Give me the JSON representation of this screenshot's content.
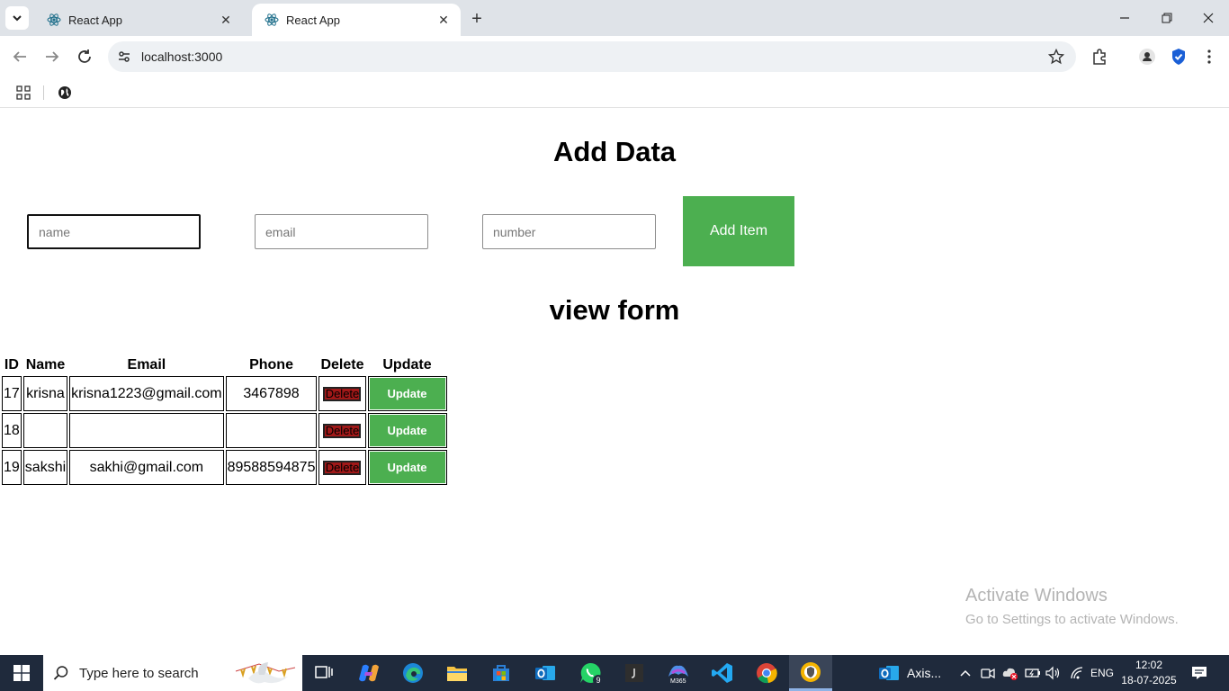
{
  "browser": {
    "tabs": [
      {
        "title": "React App",
        "active": false
      },
      {
        "title": "React App",
        "active": true
      }
    ],
    "url": "localhost:3000"
  },
  "page": {
    "add_title": "Add Data",
    "inputs": {
      "name_placeholder": "name",
      "email_placeholder": "email",
      "number_placeholder": "number"
    },
    "add_button": "Add Item",
    "view_title": "view form",
    "table": {
      "headers": [
        "ID",
        "Name",
        "Email",
        "Phone",
        "Delete",
        "Update"
      ],
      "rows": [
        {
          "id": "17",
          "name": "krisna",
          "email": "krisna1223@gmail.com",
          "phone": "3467898",
          "delete_label": "Delete",
          "update_label": "Update"
        },
        {
          "id": "18",
          "name": "",
          "email": "",
          "phone": "",
          "delete_label": "Delete",
          "update_label": "Update"
        },
        {
          "id": "19",
          "name": "sakshi",
          "email": "sakhi@gmail.com",
          "phone": "89588594875",
          "delete_label": "Delete",
          "update_label": "Update"
        }
      ]
    },
    "watermark": {
      "line1": "Activate Windows",
      "line2": "Go to Settings to activate Windows."
    }
  },
  "taskbar": {
    "search_placeholder": "Type here to search",
    "whatsapp_badge": "9",
    "notification_app": "Axis...",
    "language": "ENG",
    "time": "12:02",
    "date": "18-07-2025"
  },
  "colors": {
    "accent_green": "#4caf50",
    "delete_red": "#a11818",
    "taskbar_bg": "#1f2a3c"
  }
}
